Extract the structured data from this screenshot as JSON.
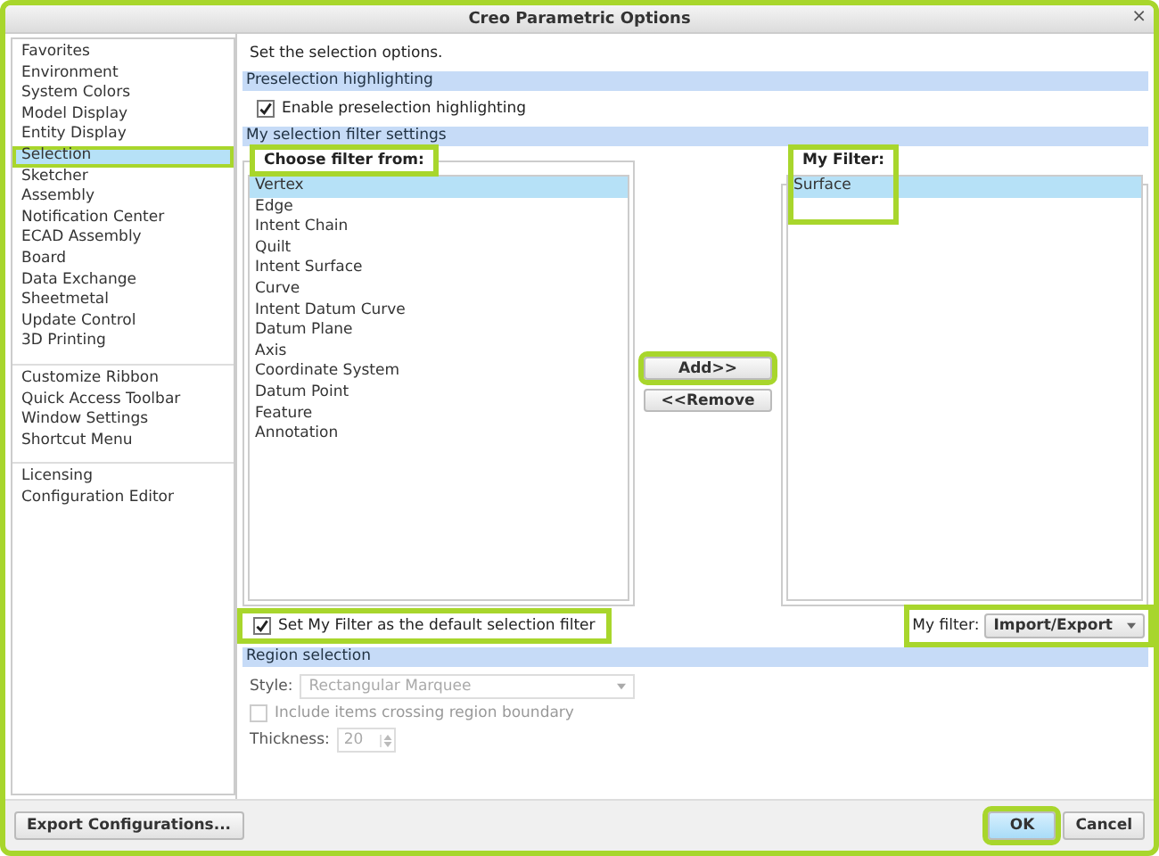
{
  "window": {
    "title": "Creo Parametric Options",
    "close": "×"
  },
  "sidebar": {
    "groups": [
      {
        "items": [
          {
            "label": "Favorites",
            "selected": false,
            "highlighted": false
          },
          {
            "label": "Environment",
            "selected": false,
            "highlighted": false
          },
          {
            "label": "System Colors",
            "selected": false,
            "highlighted": false
          },
          {
            "label": "Model Display",
            "selected": false,
            "highlighted": false
          },
          {
            "label": "Entity Display",
            "selected": false,
            "highlighted": false
          },
          {
            "label": "Selection",
            "selected": true,
            "highlighted": true
          },
          {
            "label": "Sketcher",
            "selected": false,
            "highlighted": false
          },
          {
            "label": "Assembly",
            "selected": false,
            "highlighted": false
          },
          {
            "label": "Notification Center",
            "selected": false,
            "highlighted": false
          },
          {
            "label": "ECAD Assembly",
            "selected": false,
            "highlighted": false
          },
          {
            "label": "Board",
            "selected": false,
            "highlighted": false
          },
          {
            "label": "Data Exchange",
            "selected": false,
            "highlighted": false
          },
          {
            "label": "Sheetmetal",
            "selected": false,
            "highlighted": false
          },
          {
            "label": "Update Control",
            "selected": false,
            "highlighted": false
          },
          {
            "label": "3D Printing",
            "selected": false,
            "highlighted": false
          }
        ]
      },
      {
        "items": [
          {
            "label": "Customize Ribbon",
            "selected": false,
            "highlighted": false
          },
          {
            "label": "Quick Access Toolbar",
            "selected": false,
            "highlighted": false
          },
          {
            "label": "Window Settings",
            "selected": false,
            "highlighted": false
          },
          {
            "label": "Shortcut Menu",
            "selected": false,
            "highlighted": false
          }
        ]
      },
      {
        "items": [
          {
            "label": "Licensing",
            "selected": false,
            "highlighted": false
          },
          {
            "label": "Configuration Editor",
            "selected": false,
            "highlighted": false
          }
        ]
      }
    ]
  },
  "intro": "Set the selection options.",
  "preselection": {
    "header": "Preselection highlighting",
    "checkbox": {
      "label": "Enable preselection highlighting",
      "checked": true
    }
  },
  "filter_settings": {
    "header": "My selection filter settings",
    "source": {
      "label": "Choose filter from:",
      "highlighted": true,
      "items": [
        {
          "label": "Vertex",
          "selected": true
        },
        {
          "label": "Edge",
          "selected": false
        },
        {
          "label": "Intent Chain",
          "selected": false
        },
        {
          "label": "Quilt",
          "selected": false
        },
        {
          "label": "Intent Surface",
          "selected": false
        },
        {
          "label": "Curve",
          "selected": false
        },
        {
          "label": "Intent Datum Curve",
          "selected": false
        },
        {
          "label": "Datum Plane",
          "selected": false
        },
        {
          "label": "Axis",
          "selected": false
        },
        {
          "label": "Coordinate System",
          "selected": false
        },
        {
          "label": "Datum Point",
          "selected": false
        },
        {
          "label": "Feature",
          "selected": false
        },
        {
          "label": "Annotation",
          "selected": false
        }
      ]
    },
    "add_button": {
      "label": "Add>>",
      "highlighted": true
    },
    "remove_button": {
      "label": "<<Remove",
      "highlighted": false
    },
    "target": {
      "label": "My Filter:",
      "highlighted": true,
      "items": [
        {
          "label": "Surface",
          "selected": true
        }
      ]
    },
    "default_checkbox": {
      "label": "Set My Filter as the default selection filter",
      "checked": true,
      "highlighted": true
    },
    "my_filter": {
      "label": "My filter:",
      "button": "Import/Export",
      "highlighted": true
    }
  },
  "region": {
    "header": "Region selection",
    "disabled": true,
    "style_label": "Style:",
    "style_value": "Rectangular Marquee",
    "include": {
      "label": "Include items crossing region boundary",
      "checked": false
    },
    "thickness_label": "Thickness:",
    "thickness_value": "20"
  },
  "footer": {
    "export_button": {
      "label": "Export Configurations...",
      "highlighted": false
    },
    "ok_button": {
      "label": "OK",
      "highlighted": true
    },
    "cancel_button": {
      "label": "Cancel",
      "highlighted": false
    }
  }
}
